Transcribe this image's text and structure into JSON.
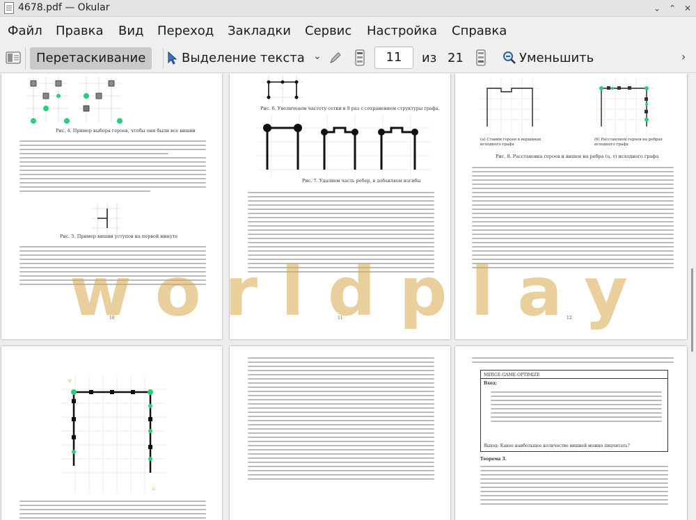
{
  "window": {
    "title": "4678.pdf — Okular",
    "buttons": {
      "minimize": "⌄",
      "maximize": "⌃",
      "close": "✕"
    }
  },
  "menu": [
    "Файл",
    "Правка",
    "Вид",
    "Переход",
    "Закладки",
    "Сервис",
    "Настройка",
    "Справка"
  ],
  "toolbar": {
    "drag_label": "Перетаскивание",
    "select_text_label": "Выделение текста",
    "current_page": "11",
    "of_label": "из",
    "total_pages": "21",
    "zoom_out_label": "Уменьшить"
  },
  "pages": {
    "p10_caption_top": "Рис. 4. Пример выбора героев, чтобы они были все вишни",
    "p10_caption_mid": "Рис. 5. Пример вишни уступов на первой минуте",
    "p10_num": "10",
    "p11_caption_top": "Рис. 6. Увеличеаем частоту сетки в 9 раз с сохранением структуры графа.",
    "p11_caption_mid": "Рис. 7. Удаляем часть ребер, в добавляем изгибы",
    "p11_num": "11",
    "p12_caption_a": "(а) Ставим героев в вершинах исходного графа",
    "p12_caption_b": "(б) Расставляем героев на ребрах исходного графа",
    "p12_caption_main": "Рис. 8. Расстановка героев и вишен на ребра (u, v) исходного графа",
    "p12_num": "12",
    "p14_heading": "MERGE-GAME-OPTIMIZE",
    "p14_input": "Вход:",
    "p14_output": "Выход: Какое наибольшее количество вишней можно пицчитать?",
    "p14_theorem": "Теорема 3."
  },
  "watermark": "worldplay"
}
